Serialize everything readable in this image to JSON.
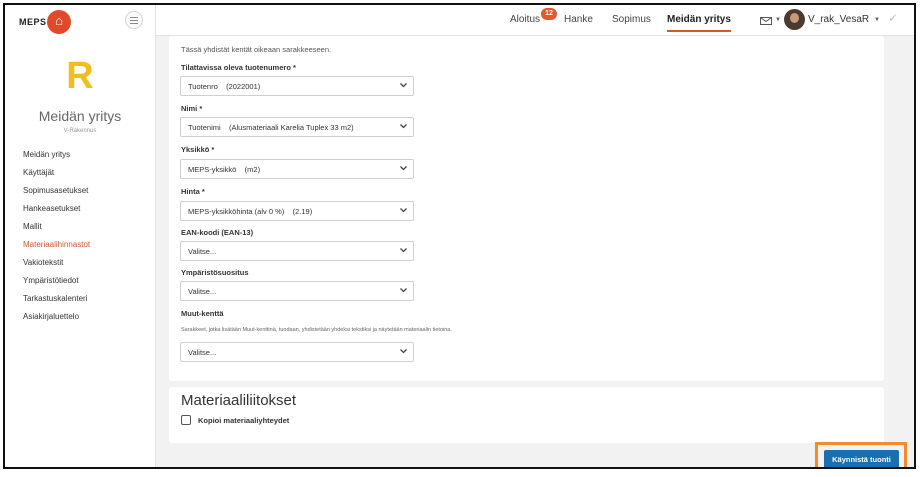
{
  "brand": {
    "name": "MEPS"
  },
  "company": {
    "letter": "R",
    "name": "Meidän yritys",
    "subtitle": "V-Rakennus"
  },
  "sidebar": {
    "items": [
      {
        "label": "Meidän yritys"
      },
      {
        "label": "Käyttäjät"
      },
      {
        "label": "Sopimusasetukset"
      },
      {
        "label": "Hankeasetukset"
      },
      {
        "label": "Mallit"
      },
      {
        "label": "Materiaalihinnastot",
        "active": true
      },
      {
        "label": "Vakiotekstit"
      },
      {
        "label": "Ympäristötiedot"
      },
      {
        "label": "Tarkastuskalenteri"
      },
      {
        "label": "Asiakirjaluettelo"
      }
    ]
  },
  "topnav": {
    "tabs": [
      {
        "label": "Aloitus"
      },
      {
        "label": "Hanke"
      },
      {
        "label": "Sopimus"
      },
      {
        "label": "Meidän yritys",
        "active": true
      }
    ],
    "notifications_count": "12",
    "user": "V_rak_VesaR"
  },
  "form": {
    "intro": "Tässä yhdistät kentät oikeaan sarakkeeseen.",
    "fields": [
      {
        "label": "Tilattavissa oleva tuotenumero *",
        "value": "Tuotenro    (2022001)"
      },
      {
        "label": "Nimi *",
        "value": "Tuotenimi    (Alusmateriaali Karelia Tuplex 33 m2)"
      },
      {
        "label": "Yksikkö *",
        "value": "MEPS-yksikkö    (m2)"
      },
      {
        "label": "Hinta *",
        "value": "MEPS-yksikköhinta (alv 0 %)    (2.19)"
      },
      {
        "label": "EAN-koodi (EAN-13)",
        "value": "Valitse..."
      },
      {
        "label": "Ympäristösuositus",
        "value": "Valitse..."
      },
      {
        "label": "Muut-kenttä",
        "value": "Valitse..."
      }
    ],
    "other_help": "Sarakkeet, jotka lisätään Muut-kenttinä, tuodaan, yhdistetään yhdeksi tekstiksi ja näytetään materiaalin tietoina."
  },
  "links": {
    "title": "Materiaaliliitokset",
    "checkbox_label": "Kopioi materiaaliyhteydet",
    "checked": false
  },
  "actions": {
    "start_import": "Käynnistä tuonti"
  },
  "colors": {
    "accent": "#d4572e",
    "primary": "#1a6fb0",
    "highlight": "#f28a2e",
    "logo": "#f0bf1f"
  }
}
